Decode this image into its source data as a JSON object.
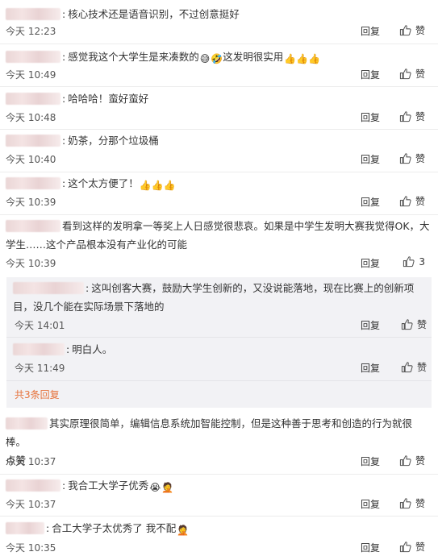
{
  "labels": {
    "reply": "回复",
    "like": "赞",
    "more_replies": "共3条回复"
  },
  "comments": [
    {
      "text": "核心技术还是语音识别，不过创意挺好",
      "time": "今天 12:23",
      "likes": ""
    },
    {
      "text": "感觉我这个大学生是来凑数的",
      "text2": "这发明很实用",
      "time": "今天 10:49",
      "likes": ""
    },
    {
      "text": "哈哈哈！蛮好蛮好",
      "time": "今天 10:48",
      "likes": ""
    },
    {
      "text": "奶茶，分那个垃圾桶",
      "time": "今天 10:40",
      "likes": ""
    },
    {
      "text": "这个太方便了！",
      "time": "今天 10:39",
      "likes": ""
    },
    {
      "line1": "看到这样的发明拿一等奖上人日感觉很悲哀。如果是中学生发明大赛我觉得OK，大",
      "line2": "学生……这个产品根本没有产业化的可能",
      "time": "今天 10:39",
      "likes": "3"
    },
    {
      "line1": "其实原理很简单，编辑信息系统加智能控制，但是这种善于思考和创造的行为就很棒。",
      "line2": "点赞",
      "time": "今天 10:37",
      "likes": ""
    },
    {
      "text": "我合工大学子优秀",
      "time": "今天 10:37",
      "likes": ""
    },
    {
      "text": "合工大学子太优秀了 我不配",
      "time": "今天 10:35",
      "likes": ""
    }
  ],
  "replies": [
    {
      "line1": "这叫创客大赛，鼓励大学生创新的，又没说能落地，现在比赛上的创新项",
      "line2": "目，没几个能在实际场景下落地的",
      "time": "今天 14:01",
      "likes": ""
    },
    {
      "text": "明白人。",
      "time": "今天 11:49",
      "likes": ""
    }
  ],
  "icons": {
    "thumb": "thumbs-up-icon",
    "grin": "grinning-sweat-emoji",
    "laugh": "rolling-laugh-emoji",
    "clap": "thumbs-up-emoji",
    "cry": "crying-emoji",
    "face": "facepalm-emoji"
  },
  "colors": {
    "more_link": "#e6723b",
    "reply_bg": "#f2f2f5"
  }
}
